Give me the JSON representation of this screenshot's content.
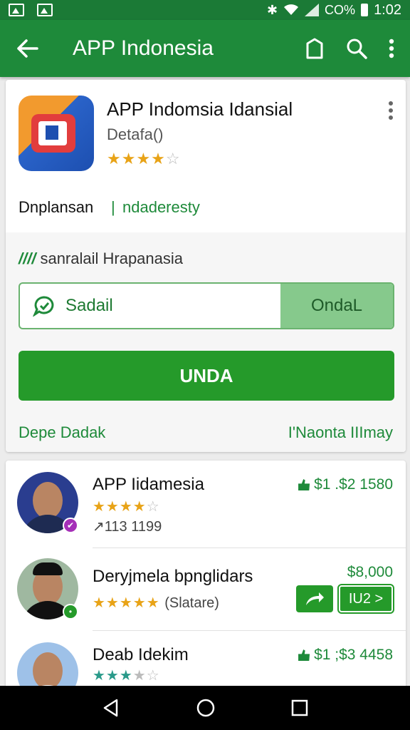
{
  "status_bar": {
    "battery_text": "CO%",
    "time": "1:02"
  },
  "app_bar": {
    "title": "APP Indonesia"
  },
  "app_card": {
    "title": "APP Indomsia Idansial",
    "subtitle": "Detafa()",
    "rating": 4,
    "meta_left": "Dnplansan",
    "meta_separator": "|",
    "meta_right": "ndaderesty",
    "section_label": "sanralail Hrapanasia",
    "section_label_mark": "////",
    "search_value": "Sadail",
    "search_button": "OndaL",
    "primary_button": "UNDA",
    "link_left": "Depe Dadak",
    "link_right": "I'Naonta IIImay"
  },
  "list": [
    {
      "title": "APP Iidamesia",
      "rating": 4,
      "count": "↗113 1199",
      "price": "$1 .$2 1580"
    },
    {
      "title": "Deryjmela bpnglidars",
      "rating": 5,
      "count": "(Slatare)",
      "price": "$8,000",
      "button_2": "IU2 >"
    },
    {
      "title": "Deab Idekim",
      "rating": 3,
      "price": "$1 ;$3 4458"
    }
  ],
  "colors": {
    "primary": "#1e8a3a",
    "accent": "#259a2a",
    "star": "#e8a317"
  }
}
